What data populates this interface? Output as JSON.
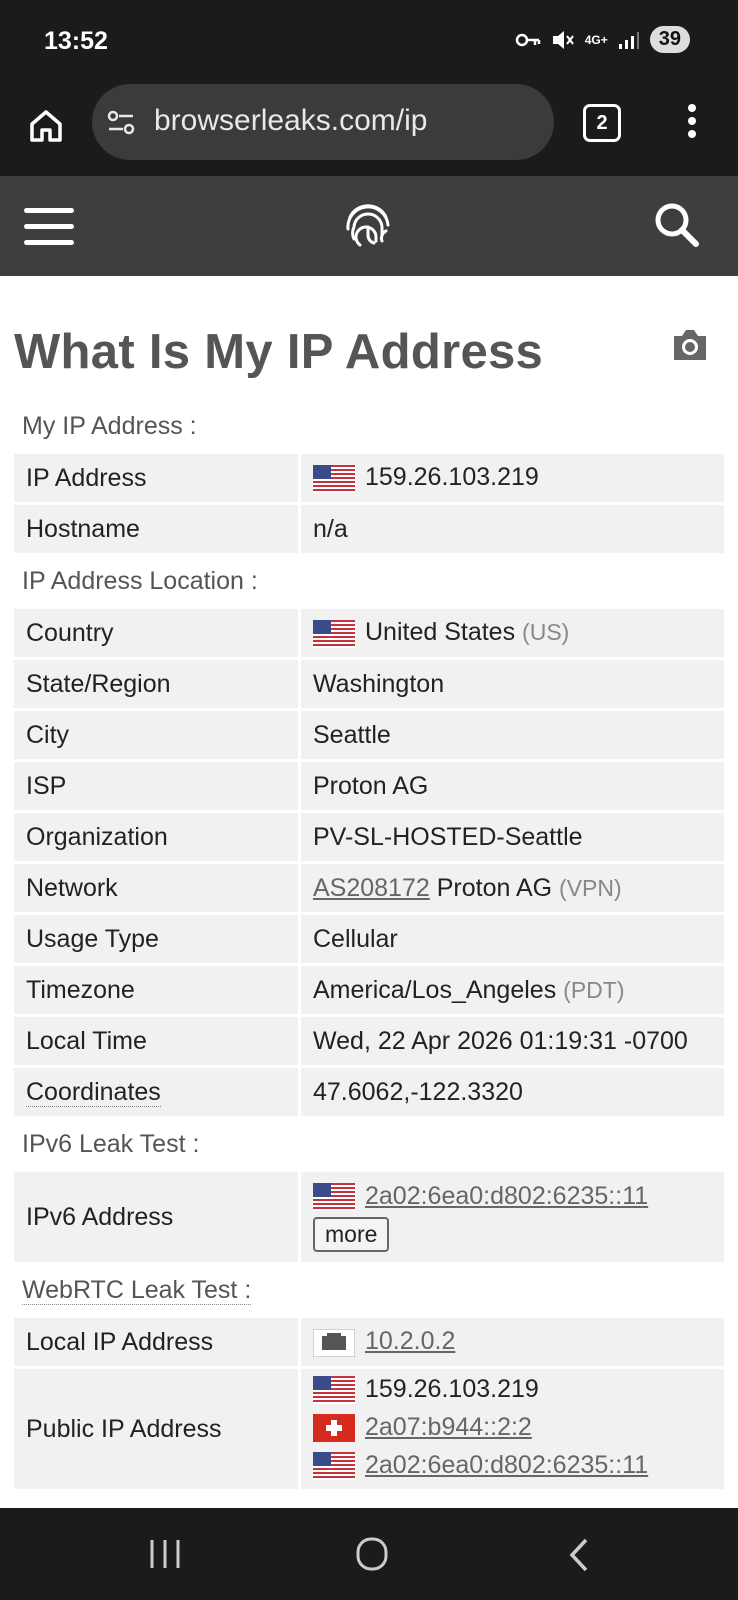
{
  "status": {
    "time": "13:52",
    "battery": "39",
    "network": "4G+"
  },
  "browser": {
    "url": "browserleaks.com/ip",
    "tab_count": "2"
  },
  "page": {
    "title": "What Is My IP Address"
  },
  "sections": {
    "my_ip": "My IP Address :",
    "location": "IP Address Location :",
    "ipv6": "IPv6 Leak Test :",
    "webrtc": "WebRTC Leak Test :"
  },
  "rows": {
    "ip_address": {
      "label": "IP Address",
      "value": "159.26.103.219"
    },
    "hostname": {
      "label": "Hostname",
      "value": "n/a"
    },
    "country": {
      "label": "Country",
      "value": "United States",
      "suffix": "(US)"
    },
    "state": {
      "label": "State/Region",
      "value": "Washington"
    },
    "city": {
      "label": "City",
      "value": "Seattle"
    },
    "isp": {
      "label": "ISP",
      "value": "Proton AG"
    },
    "organization": {
      "label": "Organization",
      "value": "PV-SL-HOSTED-Seattle"
    },
    "network": {
      "label": "Network",
      "link": "AS208172",
      "value": "Proton AG",
      "suffix": "(VPN)"
    },
    "usage": {
      "label": "Usage Type",
      "value": "Cellular"
    },
    "timezone": {
      "label": "Timezone",
      "value": "America/Los_Angeles",
      "suffix": "(PDT)"
    },
    "localtime": {
      "label": "Local Time",
      "value": "Wed, 22 Apr 2026 01:19:31 -0700"
    },
    "coords": {
      "label": "Coordinates",
      "value": "47.6062,-122.3320"
    },
    "ipv6_addr": {
      "label": "IPv6 Address",
      "value": "2a02:6ea0:d802:6235::11",
      "more": "more"
    },
    "local_ip": {
      "label": "Local IP Address",
      "value": "10.2.0.2"
    },
    "public_ip": {
      "label": "Public IP Address",
      "values": [
        "159.26.103.219",
        "2a07:b944::2:2",
        "2a02:6ea0:d802:6235::11"
      ]
    }
  },
  "icons": [
    "home-icon",
    "site-settings-icon",
    "tabs-icon",
    "more-vert-icon",
    "hamburger-icon",
    "fingerprint-icon",
    "search-icon",
    "camera-icon",
    "us-flag-icon",
    "swiss-flag-icon",
    "ethernet-icon"
  ]
}
